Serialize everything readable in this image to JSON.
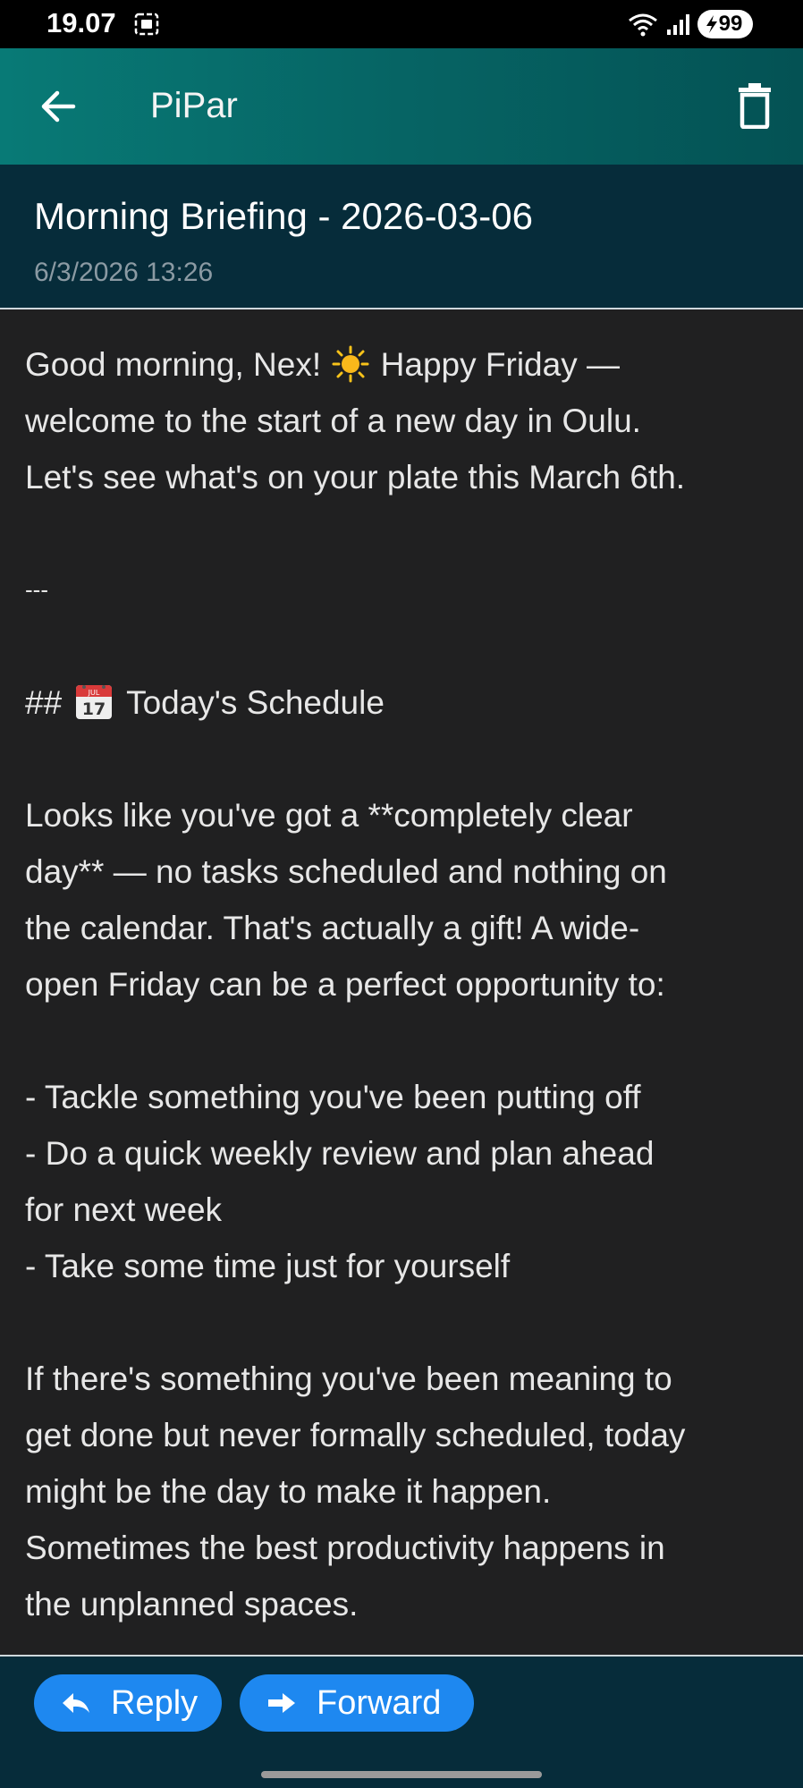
{
  "status_bar": {
    "time": "19.07",
    "battery": "99",
    "icons": [
      "screen-cast-icon",
      "wifi-icon",
      "signal-icon",
      "battery-charging-icon"
    ]
  },
  "app_bar": {
    "title": "PiPar",
    "background_color": "#087a76",
    "icons": [
      "back-arrow-icon",
      "trash-icon"
    ]
  },
  "message": {
    "subject": "Morning Briefing - 2026-03-06",
    "date": "6/3/2026 13:26",
    "body": {
      "intro_1a": "Good morning, Nex!",
      "intro_1b": "Happy Friday —",
      "intro_2": "welcome to the start of a new day in Oulu.",
      "intro_3": "Let's see what's on your plate this March 6th.",
      "divider": "---",
      "heading_prefix": "##",
      "heading_text": "Today's Schedule",
      "para1": [
        "Looks like you've got a **completely clear",
        "day** — no tasks scheduled and nothing on",
        "the calendar. That's actually a gift! A wide-",
        "open Friday can be a perfect opportunity to:"
      ],
      "list": [
        "- Tackle something you've been putting off",
        "- Do a quick weekly review and plan ahead",
        "for next week",
        "- Take some time just for yourself"
      ],
      "para2": [
        "If there's something you've been meaning to",
        "get done but never formally scheduled, today",
        "might be the day to make it happen.",
        "Sometimes the best productivity happens in",
        "the unplanned spaces."
      ],
      "calendar_emoji_day": "17",
      "calendar_emoji_month": "JUL"
    }
  },
  "actions": {
    "reply_label": "Reply",
    "forward_label": "Forward",
    "button_color": "#1e88f0"
  }
}
